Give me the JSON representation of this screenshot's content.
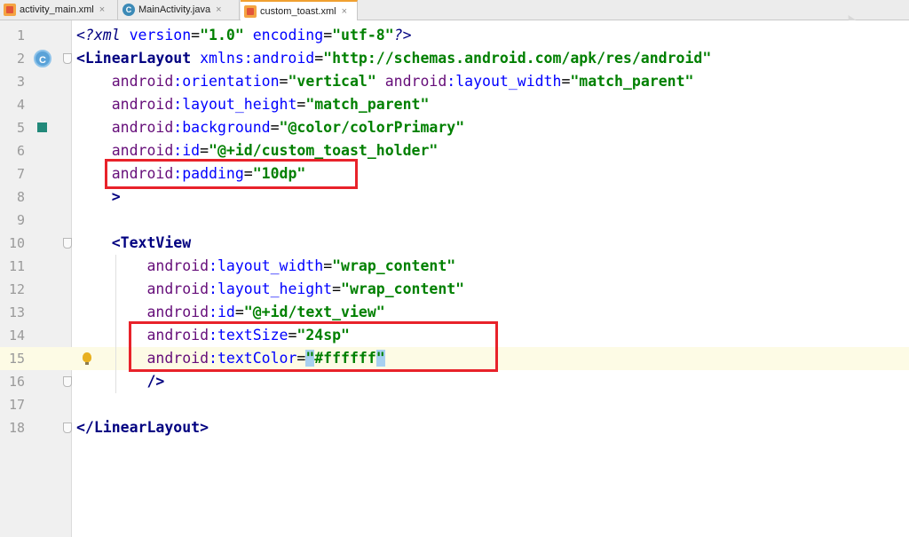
{
  "tabs": [
    {
      "label": "activity_main.xml",
      "icon": "xml-file-icon",
      "active": false
    },
    {
      "label": "MainActivity.java",
      "icon": "java-class-icon",
      "active": false
    },
    {
      "label": "custom_toast.xml",
      "icon": "xml-file-icon",
      "active": true
    }
  ],
  "close_glyph": "×",
  "gutter_c_label": "C",
  "current_line": 15,
  "lines": [
    {
      "n": "1",
      "text": "<?xml version=\"1.0\" encoding=\"utf-8\"?>"
    },
    {
      "n": "2",
      "text": "<LinearLayout xmlns:android=\"http://schemas.android.com/apk/res/android\""
    },
    {
      "n": "3",
      "text": "    android:orientation=\"vertical\" android:layout_width=\"match_parent\""
    },
    {
      "n": "4",
      "text": "    android:layout_height=\"match_parent\""
    },
    {
      "n": "5",
      "text": "    android:background=\"@color/colorPrimary\""
    },
    {
      "n": "6",
      "text": "    android:id=\"@+id/custom_toast_holder\""
    },
    {
      "n": "7",
      "text": "    android:padding=\"10dp\""
    },
    {
      "n": "8",
      "text": "    >"
    },
    {
      "n": "9",
      "text": ""
    },
    {
      "n": "10",
      "text": "    <TextView"
    },
    {
      "n": "11",
      "text": "        android:layout_width=\"wrap_content\""
    },
    {
      "n": "12",
      "text": "        android:layout_height=\"wrap_content\""
    },
    {
      "n": "13",
      "text": "        android:id=\"@+id/text_view\""
    },
    {
      "n": "14",
      "text": "        android:textSize=\"24sp\""
    },
    {
      "n": "15",
      "text": "        android:textColor=\"#ffffff\""
    },
    {
      "n": "16",
      "text": "        />"
    },
    {
      "n": "17",
      "text": ""
    },
    {
      "n": "18",
      "text": "</LinearLayout>"
    }
  ],
  "colors": {
    "tag": "#000080",
    "attribute": "#0000ff",
    "namespace": "#660e7a",
    "string": "#008000",
    "highlight_box": "#e8222a",
    "current_line_bg": "#fdfbe5"
  }
}
